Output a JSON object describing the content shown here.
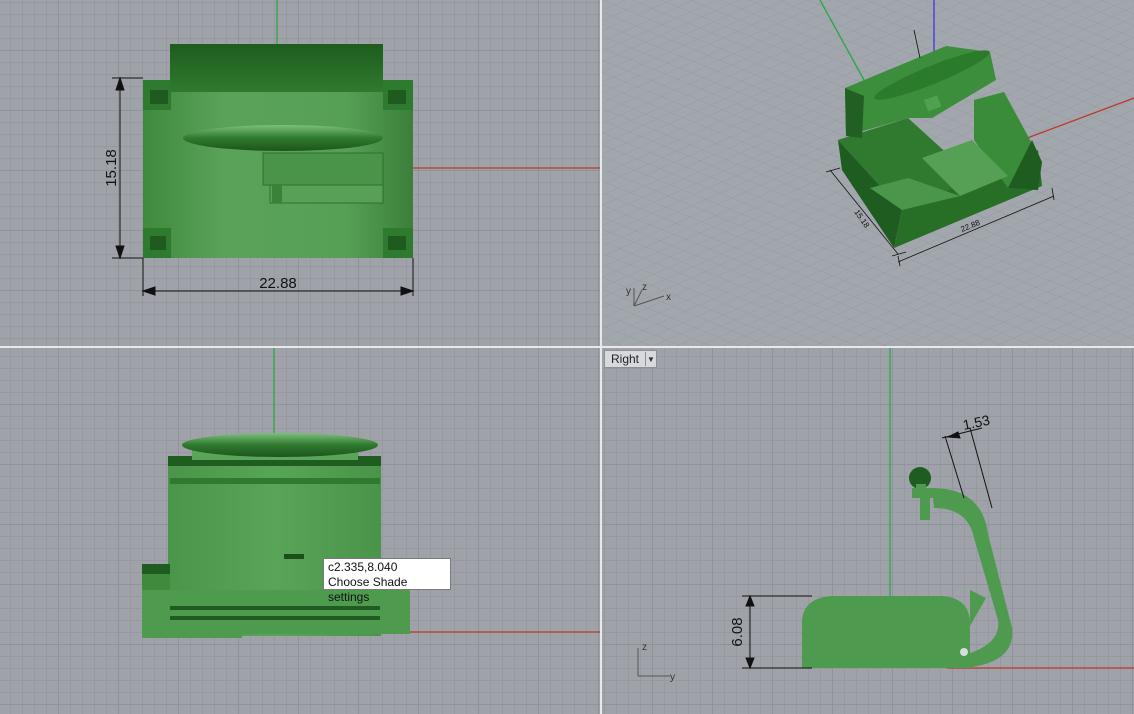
{
  "viewports": {
    "top": {
      "dimension_horizontal": "22.88",
      "dimension_vertical": "15.18"
    },
    "perspective": {
      "dimension_a": "15.18",
      "dimension_b": "22.88",
      "axis_icon": {
        "y": "y",
        "z": "z",
        "x": "x"
      }
    },
    "front": {
      "tooltip": {
        "coords": "c2.335,8.040",
        "message": "Choose Shade settings"
      }
    },
    "right": {
      "label": "Right",
      "dimension_height": "6.08",
      "dimension_small": "1.53",
      "axis_icon": {
        "z": "z",
        "y": "y"
      }
    }
  },
  "colors": {
    "model_green": "#3f8f3f",
    "model_dark": "#1f5a1f",
    "axis_x": "#c0392b",
    "axis_y": "#27a844",
    "axis_z": "#3a3ad0",
    "viewport_bg": "#9fa3a9"
  }
}
